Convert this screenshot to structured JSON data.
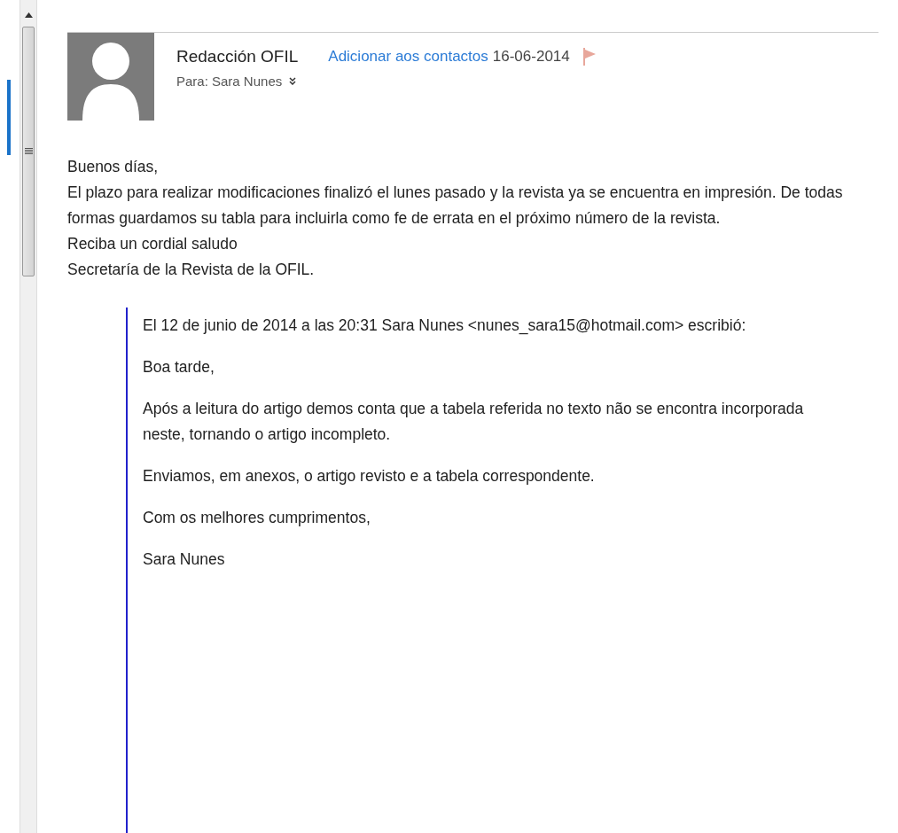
{
  "header": {
    "sender": "Redacción OFIL",
    "add_contact": "Adicionar aos contactos",
    "date": "16-06-2014",
    "to": "Para: Sara Nunes"
  },
  "body": [
    "Buenos días,",
    "El plazo para realizar modificaciones finalizó el lunes pasado y la revista ya se encuentra en impresión. De todas formas guardamos su tabla para incluirla como fe de errata en el próximo número de la revista.",
    "Reciba un cordial saludo",
    "Secretaría de la Revista de la OFIL."
  ],
  "quote": {
    "header": "El 12 de junio de 2014 a las 20:31 Sara Nunes <nunes_sara15@hotmail.com> escribió:",
    "paragraphs": [
      "Boa tarde,",
      "Após a leitura do artigo demos conta que a tabela referida no texto não se encontra incorporada neste, tornando o artigo incompleto.",
      "Enviamos, em anexos, o artigo revisto e a tabela correspondente.",
      "Com os melhores cumprimentos,",
      "Sara Nunes"
    ]
  }
}
